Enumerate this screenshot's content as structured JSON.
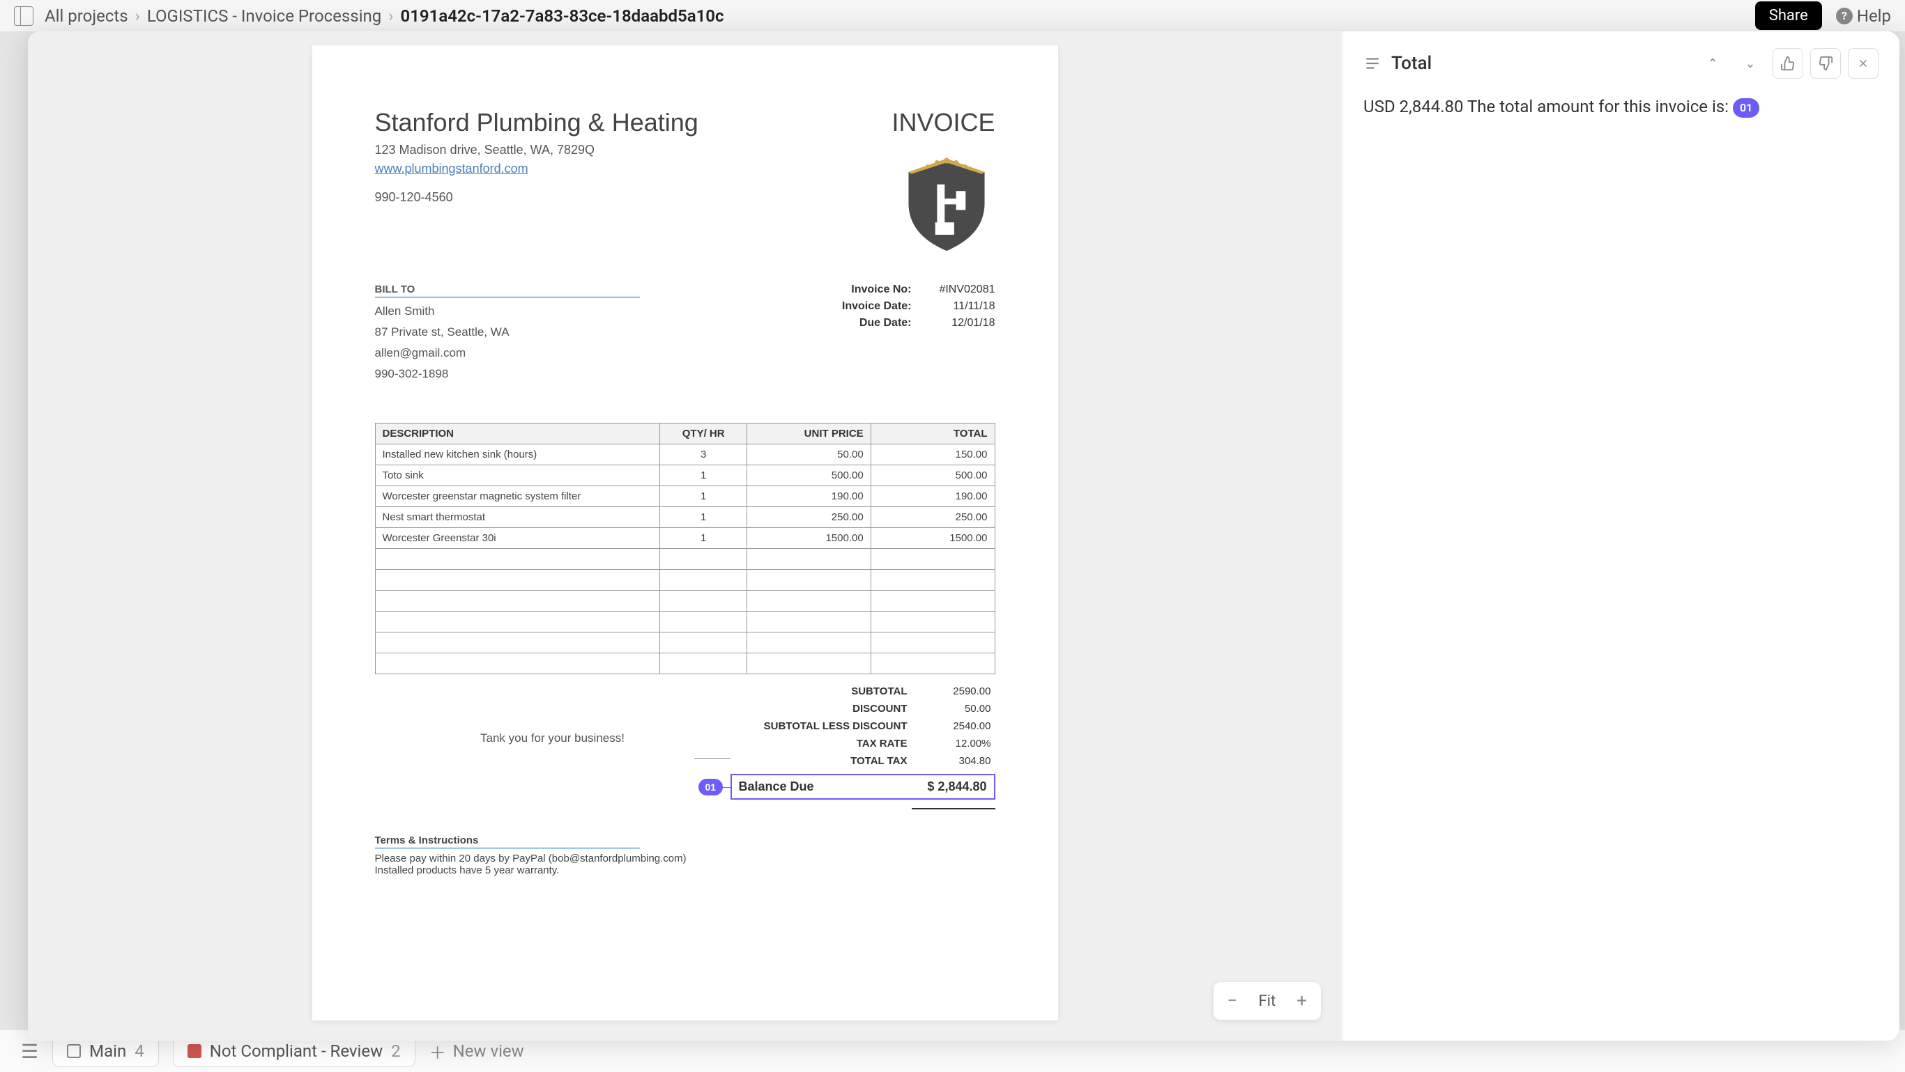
{
  "breadcrumb": {
    "root": "All projects",
    "project": "LOGISTICS - Invoice Processing",
    "current": "0191a42c-17a2-7a83-83ce-18daabd5a10c"
  },
  "header": {
    "share": "Share",
    "help": "Help"
  },
  "footer": {
    "tab_main": "Main",
    "tab_main_count": "4",
    "tab_nc": "Not Compliant - Review",
    "tab_nc_count": "2",
    "new_view": "New view"
  },
  "zoom": {
    "label": "Fit"
  },
  "invoice": {
    "company_name": "Stanford Plumbing & Heating",
    "company_address": "123 Madison drive, Seattle, WA, 7829Q",
    "company_website": "www.plumbingstanford.com",
    "company_phone": "990-120-4560",
    "title": "INVOICE",
    "bill_to_label": "BILL TO",
    "bill_name": "Allen Smith",
    "bill_address": "87 Private st, Seattle, WA",
    "bill_email": "allen@gmail.com",
    "bill_phone": "990-302-1898",
    "meta": {
      "invoice_no_label": "Invoice No:",
      "invoice_no": "#INV02081",
      "invoice_date_label": "Invoice Date:",
      "invoice_date": "11/11/18",
      "due_date_label": "Due Date:",
      "due_date": "12/01/18"
    },
    "columns": {
      "desc": "DESCRIPTION",
      "qty": "QTY/ HR",
      "unit_price": "UNIT PRICE",
      "total": "TOTAL"
    },
    "items": [
      {
        "desc": "Installed new kitchen sink (hours)",
        "qty": "3",
        "unit_price": "50.00",
        "total": "150.00"
      },
      {
        "desc": "Toto sink",
        "qty": "1",
        "unit_price": "500.00",
        "total": "500.00"
      },
      {
        "desc": "Worcester greenstar magnetic system filter",
        "qty": "1",
        "unit_price": "190.00",
        "total": "190.00"
      },
      {
        "desc": "Nest smart thermostat",
        "qty": "1",
        "unit_price": "250.00",
        "total": "250.00"
      },
      {
        "desc": "Worcester Greenstar 30i",
        "qty": "1",
        "unit_price": "1500.00",
        "total": "1500.00"
      }
    ],
    "thank_you": "Tank you for your business!",
    "totals": {
      "subtotal_label": "SUBTOTAL",
      "subtotal": "2590.00",
      "discount_label": "DISCOUNT",
      "discount": "50.00",
      "sub_less_disc_label": "SUBTOTAL LESS DISCOUNT",
      "sub_less_disc": "2540.00",
      "tax_rate_label": "TAX RATE",
      "tax_rate": "12.00%",
      "total_tax_label": "TOTAL TAX",
      "total_tax": "304.80",
      "balance_due_label": "Balance Due",
      "balance_due": "$ 2,844.80"
    },
    "annotation_tag": "01",
    "terms_label": "Terms & Instructions",
    "terms_line1": "Please pay within 20 days by PayPal (bob@stanfordplumbing.com)",
    "terms_line2": "Installed products have 5 year warranty."
  },
  "detail": {
    "title": "Total",
    "body_value": "USD 2,844.80",
    "body_text": "The total amount for this invoice is:",
    "tag": "01"
  }
}
